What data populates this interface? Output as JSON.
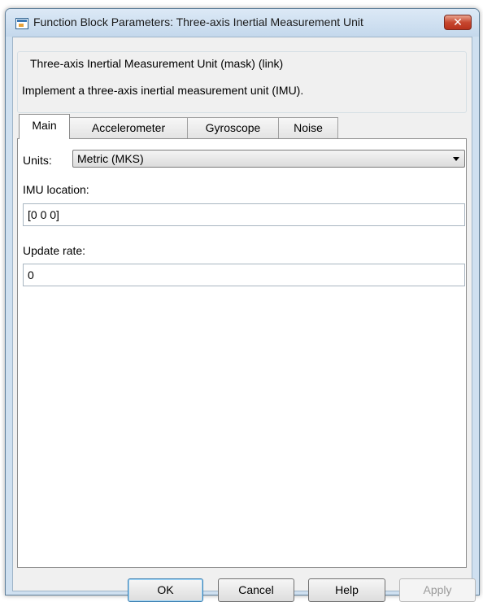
{
  "window": {
    "title": "Function Block Parameters: Three-axis Inertial Measurement Unit",
    "close_label": "✕"
  },
  "block": {
    "name": "Three-axis Inertial Measurement Unit (mask) (link)",
    "description": "Implement a three-axis inertial measurement unit (IMU)."
  },
  "tabs": [
    {
      "label": "Main",
      "active": true
    },
    {
      "label": "Accelerometer",
      "active": false
    },
    {
      "label": "Gyroscope",
      "active": false
    },
    {
      "label": "Noise",
      "active": false
    }
  ],
  "main": {
    "units_label": "Units:",
    "units_value": "Metric (MKS)",
    "imu_location_label": "IMU location:",
    "imu_location_value": "[0 0 0]",
    "update_rate_label": "Update rate:",
    "update_rate_value": "0"
  },
  "buttons": {
    "ok": "OK",
    "cancel": "Cancel",
    "help": "Help",
    "apply": "Apply"
  }
}
